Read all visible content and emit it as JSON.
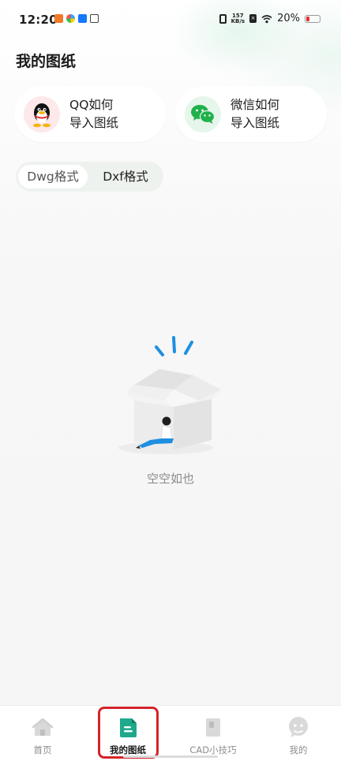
{
  "status_bar": {
    "time": "12:20",
    "net_speed_value": "157",
    "net_speed_unit": "KB/s",
    "battery": "20%",
    "colors": {
      "battery_low": "#e5312c"
    }
  },
  "page": {
    "title": "我的图纸"
  },
  "guides": [
    {
      "line1": "QQ如何",
      "line2": "导入图纸",
      "icon": "qq-penguin-icon"
    },
    {
      "line1": "微信如何",
      "line2": "导入图纸",
      "icon": "wechat-icon"
    }
  ],
  "format_tabs": [
    {
      "label": "Dwg格式",
      "selected": true
    },
    {
      "label": "Dxf格式",
      "selected": false
    }
  ],
  "empty_state": {
    "text": "空空如也",
    "icon": "empty-box-illustration"
  },
  "bottom_nav": [
    {
      "label": "首页",
      "icon": "home-icon",
      "active": false
    },
    {
      "label": "我的图纸",
      "icon": "drawing-doc-icon",
      "active": true
    },
    {
      "label": "CAD小技巧",
      "icon": "book-icon",
      "active": false
    },
    {
      "label": "我的",
      "icon": "profile-face-icon",
      "active": false
    }
  ],
  "theme": {
    "accent": "#1fa98c",
    "highlight_border": "#d6232a"
  }
}
